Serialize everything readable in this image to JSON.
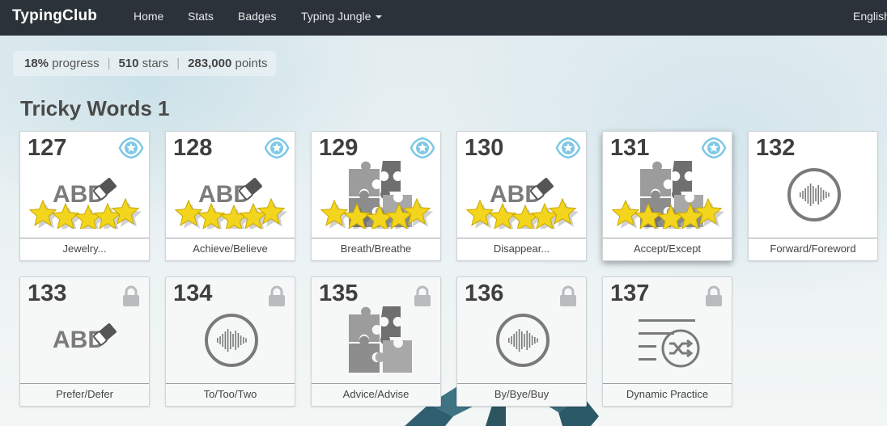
{
  "nav": {
    "brand": "TypingClub",
    "links": [
      {
        "label": "Home"
      },
      {
        "label": "Stats"
      },
      {
        "label": "Badges"
      },
      {
        "label": "Typing Jungle"
      }
    ],
    "language": "English"
  },
  "summary": {
    "progress_value": "18%",
    "progress_label": "progress",
    "stars_value": "510",
    "stars_label": "stars",
    "points_value": "283,000",
    "points_label": "points",
    "separator": "|"
  },
  "section": {
    "title": "Tricky Words 1"
  },
  "lessons": [
    {
      "number": "127",
      "label": "Jewelry...",
      "icon": "abc-eraser-icon",
      "stars": 5,
      "badge": true,
      "locked": false
    },
    {
      "number": "128",
      "label": "Achieve/Believe",
      "icon": "abc-eraser-icon",
      "stars": 5,
      "badge": true,
      "locked": false
    },
    {
      "number": "129",
      "label": "Breath/Breathe",
      "icon": "puzzle-icon",
      "stars": 5,
      "badge": true,
      "locked": false
    },
    {
      "number": "130",
      "label": "Disappear...",
      "icon": "abc-eraser-icon",
      "stars": 5,
      "badge": true,
      "locked": false
    },
    {
      "number": "131",
      "label": "Accept/Except",
      "icon": "puzzle-icon",
      "stars": 5,
      "badge": true,
      "locked": false
    },
    {
      "number": "132",
      "label": "Forward/Foreword",
      "icon": "audio-wave-icon",
      "stars": 0,
      "badge": false,
      "locked": false
    },
    {
      "number": "133",
      "label": "Prefer/Defer",
      "icon": "abc-eraser-icon",
      "stars": 0,
      "badge": false,
      "locked": true
    },
    {
      "number": "134",
      "label": "To/Too/Two",
      "icon": "audio-wave-icon",
      "stars": 0,
      "badge": false,
      "locked": true
    },
    {
      "number": "135",
      "label": "Advice/Advise",
      "icon": "puzzle-icon",
      "stars": 0,
      "badge": false,
      "locked": true
    },
    {
      "number": "136",
      "label": "By/Bye/Buy",
      "icon": "audio-wave-icon",
      "stars": 0,
      "badge": false,
      "locked": true
    },
    {
      "number": "137",
      "label": "Dynamic Practice",
      "icon": "shuffle-list-icon",
      "stars": 0,
      "badge": false,
      "locked": true
    }
  ],
  "icon_text": {
    "abc": "ABD"
  },
  "colors": {
    "navbar": "#2b3239",
    "star": "#f2d51c",
    "badge": "#7fc8e6",
    "icon_gray": "#7b7b7b"
  }
}
